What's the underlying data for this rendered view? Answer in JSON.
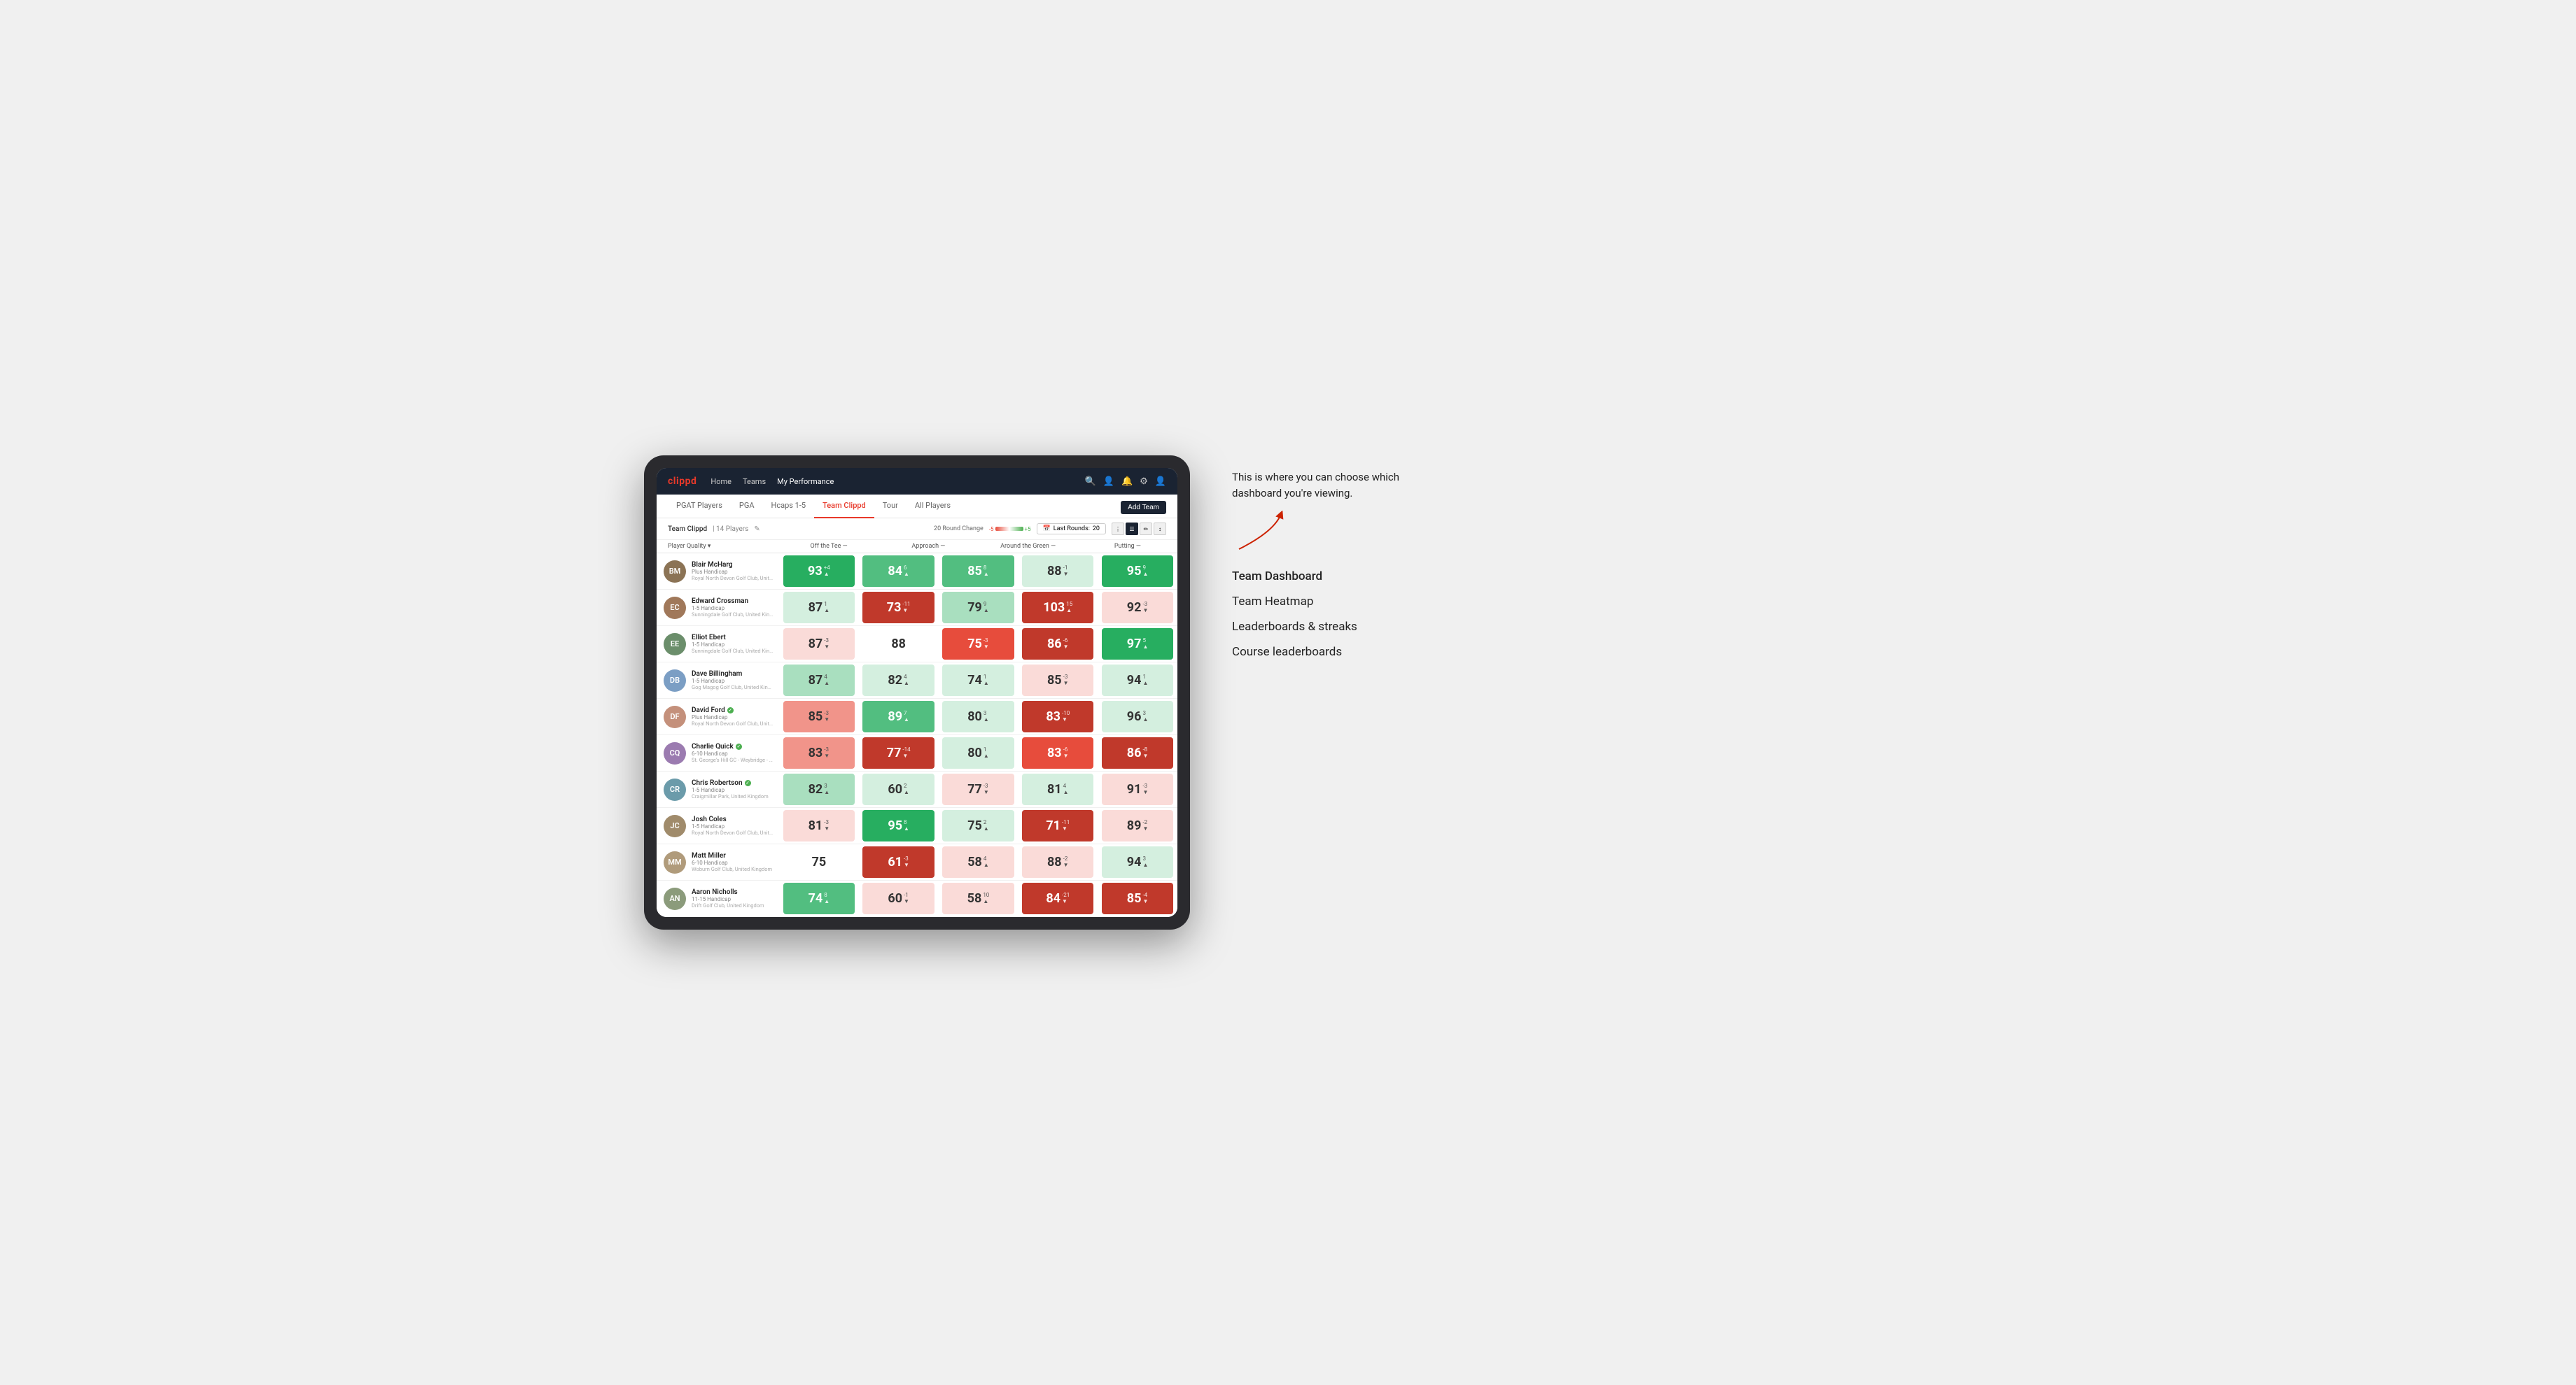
{
  "annotation": {
    "intro_text": "This is where you can choose which dashboard you're viewing.",
    "menu_items": [
      "Team Dashboard",
      "Team Heatmap",
      "Leaderboards & streaks",
      "Course leaderboards"
    ]
  },
  "nav": {
    "logo": "clippd",
    "links": [
      "Home",
      "Teams",
      "My Performance"
    ],
    "active_link": "My Performance"
  },
  "sub_nav": {
    "tabs": [
      "PGAT Players",
      "PGA",
      "Hcaps 1-5",
      "Team Clippd",
      "Tour",
      "All Players"
    ],
    "active_tab": "Team Clippd",
    "add_team_label": "Add Team"
  },
  "team_header": {
    "name": "Team Clippd",
    "separator": "|",
    "count": "14 Players",
    "round_change_label": "20 Round Change",
    "scale_neg": "-5",
    "scale_pos": "+5",
    "last_rounds_label": "Last Rounds:",
    "last_rounds_value": "20"
  },
  "table": {
    "columns": [
      "Player Quality ▾",
      "Off the Tee —",
      "Approach —",
      "Around the Green —",
      "Putting —"
    ],
    "players": [
      {
        "name": "Blair McHarg",
        "handicap": "Plus Handicap",
        "club": "Royal North Devon Golf Club, United Kingdom",
        "verified": false,
        "scores": [
          {
            "value": 93,
            "change": "+4",
            "direction": "up",
            "bg": "bg-green-dark",
            "white": true
          },
          {
            "value": 84,
            "change": "6",
            "direction": "up",
            "bg": "bg-green-med",
            "white": true
          },
          {
            "value": 85,
            "change": "8",
            "direction": "up",
            "bg": "bg-green-med",
            "white": true
          },
          {
            "value": 88,
            "change": "-1",
            "direction": "down",
            "bg": "bg-green-pale",
            "white": false
          },
          {
            "value": 95,
            "change": "9",
            "direction": "up",
            "bg": "bg-green-dark",
            "white": true
          }
        ]
      },
      {
        "name": "Edward Crossman",
        "handicap": "1-5 Handicap",
        "club": "Sunningdale Golf Club, United Kingdom",
        "verified": false,
        "scores": [
          {
            "value": 87,
            "change": "1",
            "direction": "up",
            "bg": "bg-green-pale",
            "white": false
          },
          {
            "value": 73,
            "change": "-11",
            "direction": "down",
            "bg": "bg-red-dark",
            "white": true
          },
          {
            "value": 79,
            "change": "9",
            "direction": "up",
            "bg": "bg-green-light",
            "white": false
          },
          {
            "value": 103,
            "change": "15",
            "direction": "up",
            "bg": "bg-red-dark",
            "white": true
          },
          {
            "value": 92,
            "change": "-3",
            "direction": "down",
            "bg": "bg-red-pale",
            "white": false
          }
        ]
      },
      {
        "name": "Elliot Ebert",
        "handicap": "1-5 Handicap",
        "club": "Sunningdale Golf Club, United Kingdom",
        "verified": false,
        "scores": [
          {
            "value": 87,
            "change": "-3",
            "direction": "down",
            "bg": "bg-red-pale",
            "white": false
          },
          {
            "value": 88,
            "change": "",
            "direction": "",
            "bg": "bg-white",
            "white": false
          },
          {
            "value": 75,
            "change": "-3",
            "direction": "down",
            "bg": "bg-red-med",
            "white": true
          },
          {
            "value": 86,
            "change": "-6",
            "direction": "down",
            "bg": "bg-red-dark",
            "white": true
          },
          {
            "value": 97,
            "change": "5",
            "direction": "up",
            "bg": "bg-green-dark",
            "white": true
          }
        ]
      },
      {
        "name": "Dave Billingham",
        "handicap": "1-5 Handicap",
        "club": "Gog Magog Golf Club, United Kingdom",
        "verified": false,
        "scores": [
          {
            "value": 87,
            "change": "4",
            "direction": "up",
            "bg": "bg-green-light",
            "white": false
          },
          {
            "value": 82,
            "change": "4",
            "direction": "up",
            "bg": "bg-green-pale",
            "white": false
          },
          {
            "value": 74,
            "change": "1",
            "direction": "up",
            "bg": "bg-green-pale",
            "white": false
          },
          {
            "value": 85,
            "change": "-3",
            "direction": "down",
            "bg": "bg-red-pale",
            "white": false
          },
          {
            "value": 94,
            "change": "1",
            "direction": "up",
            "bg": "bg-green-pale",
            "white": false
          }
        ]
      },
      {
        "name": "David Ford",
        "handicap": "Plus Handicap",
        "club": "Royal North Devon Golf Club, United Kingdom",
        "verified": true,
        "scores": [
          {
            "value": 85,
            "change": "-3",
            "direction": "down",
            "bg": "bg-red-light",
            "white": false
          },
          {
            "value": 89,
            "change": "7",
            "direction": "up",
            "bg": "bg-green-med",
            "white": true
          },
          {
            "value": 80,
            "change": "3",
            "direction": "up",
            "bg": "bg-green-pale",
            "white": false
          },
          {
            "value": 83,
            "change": "-10",
            "direction": "down",
            "bg": "bg-red-dark",
            "white": true
          },
          {
            "value": 96,
            "change": "3",
            "direction": "up",
            "bg": "bg-green-pale",
            "white": false
          }
        ]
      },
      {
        "name": "Charlie Quick",
        "handicap": "6-10 Handicap",
        "club": "St. George's Hill GC - Weybridge - Surrey, Uni...",
        "verified": true,
        "scores": [
          {
            "value": 83,
            "change": "-3",
            "direction": "down",
            "bg": "bg-red-light",
            "white": false
          },
          {
            "value": 77,
            "change": "-14",
            "direction": "down",
            "bg": "bg-red-dark",
            "white": true
          },
          {
            "value": 80,
            "change": "1",
            "direction": "up",
            "bg": "bg-green-pale",
            "white": false
          },
          {
            "value": 83,
            "change": "-6",
            "direction": "down",
            "bg": "bg-red-med",
            "white": true
          },
          {
            "value": 86,
            "change": "-8",
            "direction": "down",
            "bg": "bg-red-dark",
            "white": true
          }
        ]
      },
      {
        "name": "Chris Robertson",
        "handicap": "1-5 Handicap",
        "club": "Craigmillar Park, United Kingdom",
        "verified": true,
        "scores": [
          {
            "value": 82,
            "change": "3",
            "direction": "up",
            "bg": "bg-green-light",
            "white": false
          },
          {
            "value": 60,
            "change": "2",
            "direction": "up",
            "bg": "bg-green-pale",
            "white": false
          },
          {
            "value": 77,
            "change": "-3",
            "direction": "down",
            "bg": "bg-red-pale",
            "white": false
          },
          {
            "value": 81,
            "change": "4",
            "direction": "up",
            "bg": "bg-green-pale",
            "white": false
          },
          {
            "value": 91,
            "change": "-3",
            "direction": "down",
            "bg": "bg-red-pale",
            "white": false
          }
        ]
      },
      {
        "name": "Josh Coles",
        "handicap": "1-5 Handicap",
        "club": "Royal North Devon Golf Club, United Kingdom",
        "verified": false,
        "scores": [
          {
            "value": 81,
            "change": "-3",
            "direction": "down",
            "bg": "bg-red-pale",
            "white": false
          },
          {
            "value": 95,
            "change": "8",
            "direction": "up",
            "bg": "bg-green-dark",
            "white": true
          },
          {
            "value": 75,
            "change": "2",
            "direction": "up",
            "bg": "bg-green-pale",
            "white": false
          },
          {
            "value": 71,
            "change": "-11",
            "direction": "down",
            "bg": "bg-red-dark",
            "white": true
          },
          {
            "value": 89,
            "change": "-2",
            "direction": "down",
            "bg": "bg-red-pale",
            "white": false
          }
        ]
      },
      {
        "name": "Matt Miller",
        "handicap": "6-10 Handicap",
        "club": "Woburn Golf Club, United Kingdom",
        "verified": false,
        "scores": [
          {
            "value": 75,
            "change": "",
            "direction": "",
            "bg": "bg-white",
            "white": false
          },
          {
            "value": 61,
            "change": "-3",
            "direction": "down",
            "bg": "bg-red-dark",
            "white": true
          },
          {
            "value": 58,
            "change": "4",
            "direction": "up",
            "bg": "bg-red-pale",
            "white": false
          },
          {
            "value": 88,
            "change": "-2",
            "direction": "down",
            "bg": "bg-red-pale",
            "white": false
          },
          {
            "value": 94,
            "change": "3",
            "direction": "up",
            "bg": "bg-green-pale",
            "white": false
          }
        ]
      },
      {
        "name": "Aaron Nicholls",
        "handicap": "11-15 Handicap",
        "club": "Drift Golf Club, United Kingdom",
        "verified": false,
        "scores": [
          {
            "value": 74,
            "change": "8",
            "direction": "up",
            "bg": "bg-green-med",
            "white": true
          },
          {
            "value": 60,
            "change": "-1",
            "direction": "down",
            "bg": "bg-red-pale",
            "white": false
          },
          {
            "value": 58,
            "change": "10",
            "direction": "up",
            "bg": "bg-red-pale",
            "white": false
          },
          {
            "value": 84,
            "change": "-21",
            "direction": "down",
            "bg": "bg-red-dark",
            "white": true
          },
          {
            "value": 85,
            "change": "-4",
            "direction": "down",
            "bg": "bg-red-dark",
            "white": true
          }
        ]
      }
    ]
  }
}
